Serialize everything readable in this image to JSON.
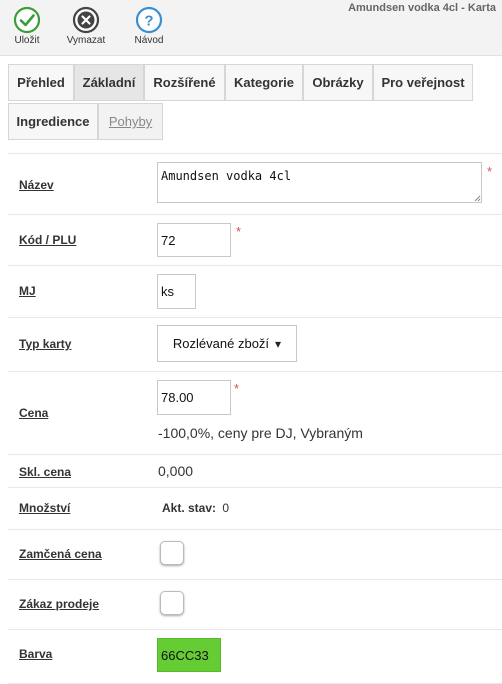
{
  "window": {
    "title": "Amundsen vodka 4cl - Karta"
  },
  "toolbar": {
    "save": {
      "label": "Uložit",
      "icon": "check-circle-icon",
      "color": "#3a9d3a"
    },
    "delete": {
      "label": "Vymazat",
      "icon": "x-circle-icon",
      "color": "#444444"
    },
    "help": {
      "label": "Návod",
      "icon": "question-circle-icon",
      "color": "#3b8fd1"
    }
  },
  "tabs": [
    {
      "label": "Přehled"
    },
    {
      "label": "Základní",
      "active": true
    },
    {
      "label": "Rozšířené"
    },
    {
      "label": "Kategorie"
    },
    {
      "label": "Obrázky"
    },
    {
      "label": "Pro veřejnost"
    },
    {
      "label": "Ingredience"
    },
    {
      "label": "Pohyby"
    }
  ],
  "form": {
    "name": {
      "label": "Název",
      "value": "Amundsen vodka 4cl",
      "required": "*"
    },
    "code": {
      "label": "Kód / PLU",
      "value": "72",
      "required": "*"
    },
    "unit": {
      "label": "MJ",
      "value": "ks"
    },
    "card_type": {
      "label": "Typ karty",
      "value": "Rozlévané zboží",
      "arrow": "▾"
    },
    "price": {
      "label": "Cena",
      "value": "78.00",
      "required": "*",
      "note": "-100,0%, ceny pre DJ, Vybraným"
    },
    "stock_price": {
      "label": "Skl. cena",
      "value": "0,000"
    },
    "quantity": {
      "label": "Množství",
      "current_label": "Akt. stav:",
      "current_value": "0"
    },
    "locked_price": {
      "label": "Zamčená cena",
      "checked": false
    },
    "sale_ban": {
      "label": "Zákaz prodeje",
      "checked": false
    },
    "color": {
      "label": "Barva",
      "value": "66CC33",
      "swatch": "#66cc33"
    }
  }
}
